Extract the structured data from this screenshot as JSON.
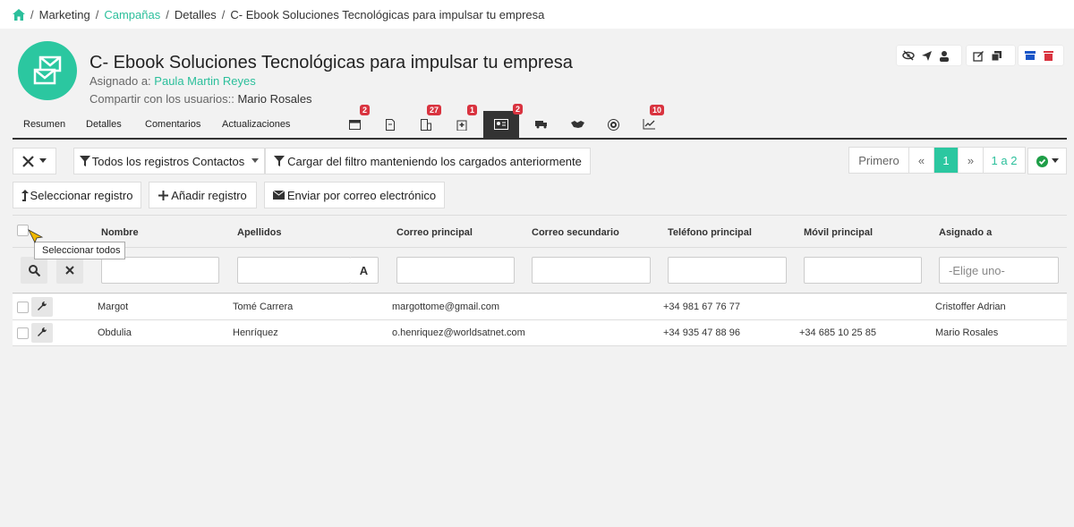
{
  "breadcrumb": {
    "items": [
      "Marketing",
      "Campañas",
      "Detalles",
      "C- Ebook Soluciones Tecnológicas para impulsar tu empresa"
    ],
    "separator": "/"
  },
  "header": {
    "title": "C- Ebook Soluciones Tecnológicas para impulsar tu empresa",
    "assigned_label": "Asignado a:",
    "assigned_value": "Paula Martin Reyes",
    "shared_label": "Compartir con los usuarios::",
    "shared_value": "Mario Rosales"
  },
  "tabs": {
    "labels": [
      "Resumen",
      "Detalles",
      "Comentarios",
      "Actualizaciones"
    ],
    "icon_badges": [
      "2",
      "27",
      "1",
      "2",
      "10"
    ]
  },
  "toolbar": {
    "filter_dropdown": "Todos los registros Contactos",
    "load_filter": "Cargar del filtro manteniendo los cargados anteriormente",
    "select_record": "Seleccionar registro",
    "add_record": "Añadir registro",
    "send_email": "Enviar por correo electrónico"
  },
  "pager": {
    "first": "Primero",
    "prev": "«",
    "current": "1",
    "next": "»",
    "range": "1 a 2"
  },
  "table": {
    "columns": [
      "Nombre",
      "Apellidos",
      "Correo principal",
      "Correo secundario",
      "Teléfono principal",
      "Móvil principal",
      "Asignado a"
    ],
    "assigned_filter_placeholder": "-Elige uno-",
    "text_filter_button": "A",
    "rows": [
      [
        "Margot",
        "Tomé Carrera",
        "margottome@gmail.com",
        "",
        "+34 981 67 76 77",
        "",
        "Cristoffer Adrian"
      ],
      [
        "Obdulia",
        "Henríquez",
        "o.henriquez@worldsatnet.com",
        "",
        "+34 935 47 88 96",
        "+34 685 10 25 85",
        "Mario Rosales"
      ]
    ]
  },
  "tooltip": "Seleccionar todos",
  "colors": {
    "accent": "#2bc7a0",
    "danger": "#d9333f",
    "dark": "#333333"
  }
}
